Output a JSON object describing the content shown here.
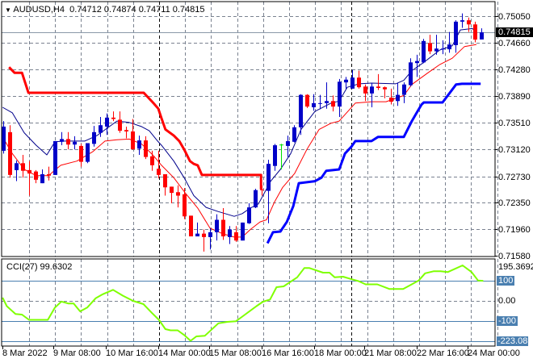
{
  "header": {
    "menu_icon": "triangle-down-icon",
    "symbol": "AUDUSD,H4",
    "open": "0.74712",
    "high": "0.74874",
    "low": "0.74711",
    "close": "0.74815"
  },
  "current_price": "0.74815",
  "colors": {
    "bull": "#0000c8",
    "bear": "#ff0000",
    "doji": "#00e000",
    "ma_fast": "#00008b",
    "ma_slow": "#ff0000",
    "upper_band": "#ff0000",
    "lower_band": "#0000ff",
    "cci": "#7fff00",
    "level": "#4a7fb0",
    "grid": "#7a8290"
  },
  "price_axis": [
    "0.75050",
    "0.74660",
    "0.74280",
    "0.73890",
    "0.73510",
    "0.73120",
    "0.72730",
    "0.72350",
    "0.71960",
    "0.71580"
  ],
  "time_axis": [
    "8 Mar 2022",
    "9 Mar 08:00",
    "10 Mar 16:00",
    "14 Mar 00:00",
    "15 Mar 08:00",
    "16 Mar 16:00",
    "18 Mar 00:00",
    "21 Mar 08:00",
    "22 Mar 16:00",
    "24 Mar 00:00"
  ],
  "cci": {
    "label": "CCI(27) 99.6302",
    "max_label": "195.3692",
    "min_label": "-223.08",
    "level_labels": [
      "100",
      "0.00",
      "-100"
    ],
    "levels": [
      100,
      -100,
      -200
    ],
    "points": [
      [
        -0.1,
        16
      ],
      [
        0.55,
        -26
      ],
      [
        1.9,
        -65
      ],
      [
        2.9,
        -68
      ],
      [
        4,
        -94
      ],
      [
        6.9,
        -94
      ],
      [
        8,
        -33
      ],
      [
        9,
        -3
      ],
      [
        10.1,
        -13
      ],
      [
        10.9,
        -13
      ],
      [
        11.9,
        -52
      ],
      [
        13,
        -33
      ],
      [
        14.3,
        13
      ],
      [
        15.4,
        33
      ],
      [
        17,
        55
      ],
      [
        18.5,
        26
      ],
      [
        20.1,
        0
      ],
      [
        21.7,
        -16
      ],
      [
        23,
        -59
      ],
      [
        24.1,
        -94
      ],
      [
        25.1,
        -140
      ],
      [
        25.9,
        -146
      ],
      [
        27,
        -146
      ],
      [
        28,
        -169
      ],
      [
        29,
        -198
      ],
      [
        29.9,
        -176
      ],
      [
        31.2,
        -173
      ],
      [
        33.3,
        -111
      ],
      [
        34.7,
        -104
      ],
      [
        36,
        -101
      ],
      [
        37,
        -78
      ],
      [
        39.2,
        -26
      ],
      [
        40.2,
        -4
      ],
      [
        41.3,
        7
      ],
      [
        42.3,
        68
      ],
      [
        43.4,
        72
      ],
      [
        45.5,
        117
      ],
      [
        46.6,
        163
      ],
      [
        47.4,
        163
      ],
      [
        49.5,
        140
      ],
      [
        50.5,
        140
      ],
      [
        51.3,
        117
      ],
      [
        52.6,
        120
      ],
      [
        54,
        107
      ],
      [
        55,
        98
      ],
      [
        56.1,
        82
      ],
      [
        57.9,
        82
      ],
      [
        59.8,
        59
      ],
      [
        61.9,
        59
      ],
      [
        63,
        78
      ],
      [
        64.3,
        101
      ],
      [
        65.3,
        137
      ],
      [
        66.6,
        147
      ],
      [
        67.7,
        147
      ],
      [
        68.8,
        143
      ],
      [
        71.1,
        176
      ],
      [
        72.5,
        143
      ],
      [
        73.5,
        101
      ],
      [
        74.3,
        99.63
      ]
    ]
  },
  "chart_data": {
    "type": "candlestick",
    "title": "AUDUSD,H4",
    "candles_ohlc": [
      [
        0.731,
        0.7353,
        0.7306,
        0.7345
      ],
      [
        0.7337,
        0.7347,
        0.7271,
        0.7275
      ],
      [
        0.7282,
        0.7296,
        0.7266,
        0.7292
      ],
      [
        0.7292,
        0.7304,
        0.7271,
        0.7281
      ],
      [
        0.7282,
        0.7295,
        0.7245,
        0.7277
      ],
      [
        0.728,
        0.7282,
        0.7263,
        0.7268
      ],
      [
        0.7263,
        0.7283,
        0.7263,
        0.7276
      ],
      [
        0.7276,
        0.7287,
        0.7267,
        0.7274
      ],
      [
        0.7275,
        0.7324,
        0.7275,
        0.7324
      ],
      [
        0.7323,
        0.7337,
        0.7318,
        0.7327
      ],
      [
        0.7327,
        0.7337,
        0.7312,
        0.7319
      ],
      [
        0.7319,
        0.7331,
        0.7312,
        0.7323
      ],
      [
        0.7317,
        0.732,
        0.7287,
        0.7294
      ],
      [
        0.7294,
        0.7321,
        0.7292,
        0.7321
      ],
      [
        0.732,
        0.7346,
        0.7316,
        0.7337
      ],
      [
        0.7336,
        0.7359,
        0.733,
        0.7347
      ],
      [
        0.7345,
        0.7364,
        0.7333,
        0.7358
      ],
      [
        0.7358,
        0.7367,
        0.7353,
        0.7356
      ],
      [
        0.7355,
        0.7367,
        0.7336,
        0.7339
      ],
      [
        0.734,
        0.7345,
        0.7328,
        0.7338
      ],
      [
        0.7338,
        0.7356,
        0.7312,
        0.7312
      ],
      [
        0.7313,
        0.7332,
        0.7304,
        0.7325
      ],
      [
        0.7325,
        0.7331,
        0.7298,
        0.7301
      ],
      [
        0.7302,
        0.731,
        0.7281,
        0.7289
      ],
      [
        0.7284,
        0.731,
        0.727,
        0.7275
      ],
      [
        0.7276,
        0.7276,
        0.7245,
        0.7257
      ],
      [
        0.7258,
        0.7258,
        0.7234,
        0.7249
      ],
      [
        0.725,
        0.726,
        0.7228,
        0.7245
      ],
      [
        0.7247,
        0.7256,
        0.7211,
        0.7215
      ],
      [
        0.7216,
        0.7216,
        0.7186,
        0.7186
      ],
      [
        0.7186,
        0.7206,
        0.7186,
        0.719
      ],
      [
        0.719,
        0.7196,
        0.7164,
        0.7185
      ],
      [
        0.7185,
        0.7198,
        0.7167,
        0.7192
      ],
      [
        0.7192,
        0.7218,
        0.718,
        0.721
      ],
      [
        0.721,
        0.7227,
        0.7181,
        0.7186
      ],
      [
        0.7185,
        0.7201,
        0.7175,
        0.7196
      ],
      [
        0.7192,
        0.7201,
        0.7178,
        0.718
      ],
      [
        0.718,
        0.7206,
        0.718,
        0.7206
      ],
      [
        0.7205,
        0.7234,
        0.7204,
        0.7228
      ],
      [
        0.7228,
        0.7255,
        0.7227,
        0.7253
      ],
      [
        0.7254,
        0.726,
        0.7245,
        0.7253
      ],
      [
        0.7252,
        0.7297,
        0.7205,
        0.7291
      ],
      [
        0.7288,
        0.732,
        0.7281,
        0.7318
      ],
      [
        0.7319,
        0.732,
        0.7283,
        0.7319
      ],
      [
        0.7317,
        0.7332,
        0.7301,
        0.7324
      ],
      [
        0.7323,
        0.7347,
        0.7322,
        0.7344
      ],
      [
        0.7344,
        0.7392,
        0.7333,
        0.7391
      ],
      [
        0.7391,
        0.7392,
        0.7372,
        0.7374
      ],
      [
        0.7373,
        0.7392,
        0.7368,
        0.7379
      ],
      [
        0.7378,
        0.7391,
        0.737,
        0.7379
      ],
      [
        0.7379,
        0.7409,
        0.7371,
        0.7382
      ],
      [
        0.7382,
        0.739,
        0.7367,
        0.7374
      ],
      [
        0.7374,
        0.7414,
        0.7359,
        0.741
      ],
      [
        0.7409,
        0.7417,
        0.74,
        0.7413
      ],
      [
        0.74,
        0.7427,
        0.74,
        0.7416
      ],
      [
        0.7416,
        0.7426,
        0.74,
        0.7402
      ],
      [
        0.7403,
        0.7406,
        0.7382,
        0.7393
      ],
      [
        0.7393,
        0.7408,
        0.7373,
        0.7403
      ],
      [
        0.7403,
        0.7421,
        0.7398,
        0.7401
      ],
      [
        0.7402,
        0.7403,
        0.7386,
        0.7399
      ],
      [
        0.7387,
        0.74,
        0.7377,
        0.7381
      ],
      [
        0.7382,
        0.7408,
        0.7375,
        0.7391
      ],
      [
        0.7391,
        0.7409,
        0.7379,
        0.7406
      ],
      [
        0.7405,
        0.7444,
        0.7403,
        0.7438
      ],
      [
        0.7437,
        0.7449,
        0.7417,
        0.744
      ],
      [
        0.7438,
        0.7472,
        0.7437,
        0.7469
      ],
      [
        0.7466,
        0.7478,
        0.745,
        0.7454
      ],
      [
        0.7454,
        0.7478,
        0.7449,
        0.7458
      ],
      [
        0.7457,
        0.747,
        0.745,
        0.7458
      ],
      [
        0.7457,
        0.7482,
        0.7452,
        0.7464
      ],
      [
        0.7463,
        0.7499,
        0.7452,
        0.7497
      ],
      [
        0.7497,
        0.7509,
        0.7488,
        0.7499
      ],
      [
        0.7499,
        0.7503,
        0.7482,
        0.7493
      ],
      [
        0.7493,
        0.7497,
        0.7467,
        0.7471
      ],
      [
        0.74712,
        0.74874,
        0.74711,
        0.74815
      ]
    ],
    "ma_fast": [
      [
        -0.1,
        0.7373
      ],
      [
        1.4,
        0.7365
      ],
      [
        3.25,
        0.7336
      ],
      [
        5.1,
        0.7318
      ],
      [
        6.75,
        0.7304
      ],
      [
        8,
        0.7323
      ],
      [
        9.5,
        0.7324
      ],
      [
        12.6,
        0.7324
      ],
      [
        14.5,
        0.7332
      ],
      [
        17.6,
        0.7353
      ],
      [
        19.5,
        0.7351
      ],
      [
        21.4,
        0.7345
      ],
      [
        22.6,
        0.7339
      ],
      [
        23.9,
        0.7324
      ],
      [
        24.5,
        0.7318
      ],
      [
        26.4,
        0.7295
      ],
      [
        28,
        0.7271
      ],
      [
        29.5,
        0.7245
      ],
      [
        31.4,
        0.7228
      ],
      [
        33.25,
        0.7222
      ],
      [
        35.75,
        0.7215
      ],
      [
        37,
        0.7219
      ],
      [
        38.25,
        0.7227
      ],
      [
        39.5,
        0.7233
      ],
      [
        41.4,
        0.7266
      ],
      [
        42.9,
        0.7283
      ],
      [
        44.5,
        0.7306
      ],
      [
        46.1,
        0.7341
      ],
      [
        48.25,
        0.7367
      ],
      [
        50.75,
        0.7379
      ],
      [
        52,
        0.7382
      ],
      [
        53.25,
        0.7402
      ],
      [
        55.1,
        0.7407
      ],
      [
        57,
        0.7408
      ],
      [
        60.75,
        0.7407
      ],
      [
        62,
        0.7412
      ],
      [
        63.25,
        0.7426
      ],
      [
        65.1,
        0.7438
      ],
      [
        67.6,
        0.7456
      ],
      [
        69.5,
        0.7462
      ],
      [
        70.75,
        0.7485
      ],
      [
        72.6,
        0.7487
      ],
      [
        73.25,
        0.7482
      ]
    ],
    "ma_slow": [
      [
        -0.1,
        0.733
      ],
      [
        1.4,
        0.7306
      ],
      [
        3.25,
        0.7283
      ],
      [
        5.1,
        0.7274
      ],
      [
        7,
        0.7274
      ],
      [
        8.9,
        0.7289
      ],
      [
        11.4,
        0.7295
      ],
      [
        13.9,
        0.7309
      ],
      [
        15.75,
        0.7324
      ],
      [
        17.6,
        0.7326
      ],
      [
        19.5,
        0.7327
      ],
      [
        21.4,
        0.732
      ],
      [
        23.25,
        0.7303
      ],
      [
        24.5,
        0.7289
      ],
      [
        26.4,
        0.7271
      ],
      [
        28.25,
        0.7248
      ],
      [
        30.1,
        0.7227
      ],
      [
        32,
        0.7198
      ],
      [
        33.9,
        0.719
      ],
      [
        35.75,
        0.7185
      ],
      [
        37,
        0.7185
      ],
      [
        38.25,
        0.7196
      ],
      [
        39.75,
        0.7207
      ],
      [
        40.75,
        0.721
      ],
      [
        42,
        0.7236
      ],
      [
        43.25,
        0.7257
      ],
      [
        45.1,
        0.7277
      ],
      [
        47,
        0.7312
      ],
      [
        48.9,
        0.7341
      ],
      [
        50.75,
        0.735
      ],
      [
        52,
        0.7353
      ],
      [
        54.5,
        0.7379
      ],
      [
        57,
        0.7381
      ],
      [
        59.25,
        0.7381
      ],
      [
        62,
        0.739
      ],
      [
        63.25,
        0.7406
      ],
      [
        65.75,
        0.7423
      ],
      [
        67.6,
        0.7435
      ],
      [
        69.5,
        0.7444
      ],
      [
        71.4,
        0.7461
      ],
      [
        73.25,
        0.7464
      ]
    ],
    "upper_band": [
      [
        0.9,
        0.7431
      ],
      [
        1.75,
        0.7423
      ],
      [
        2.9,
        0.7423
      ],
      [
        3.9,
        0.7394
      ],
      [
        21.75,
        0.7394
      ],
      [
        23.25,
        0.7379
      ],
      [
        24,
        0.7371
      ],
      [
        24.5,
        0.7357
      ],
      [
        25.1,
        0.7341
      ],
      [
        26.4,
        0.7332
      ],
      [
        27.25,
        0.7324
      ],
      [
        28,
        0.7312
      ],
      [
        28.9,
        0.7295
      ],
      [
        29.5,
        0.7291
      ],
      [
        30.1,
        0.7289
      ],
      [
        30.75,
        0.7275
      ],
      [
        39.9,
        0.7275
      ],
      [
        39.9,
        0.7254
      ]
    ],
    "lower_band": [
      [
        40.9,
        0.7176
      ],
      [
        41.75,
        0.7192
      ],
      [
        42.9,
        0.7193
      ],
      [
        43.9,
        0.7207
      ],
      [
        44.9,
        0.723
      ],
      [
        45.75,
        0.7263
      ],
      [
        48.25,
        0.7266
      ],
      [
        49.25,
        0.7271
      ],
      [
        50,
        0.7281
      ],
      [
        52,
        0.7283
      ],
      [
        52.9,
        0.7306
      ],
      [
        53.9,
        0.7316
      ],
      [
        54.5,
        0.7324
      ],
      [
        57,
        0.7324
      ],
      [
        58,
        0.733
      ],
      [
        62,
        0.733
      ],
      [
        63.25,
        0.7353
      ],
      [
        64,
        0.7365
      ],
      [
        64.75,
        0.7377
      ],
      [
        65.1,
        0.738
      ],
      [
        68,
        0.738
      ],
      [
        70.1,
        0.7406
      ],
      [
        71,
        0.7407
      ],
      [
        73.9,
        0.7407
      ]
    ],
    "ylim": [
      0.7158,
      0.7505
    ]
  }
}
